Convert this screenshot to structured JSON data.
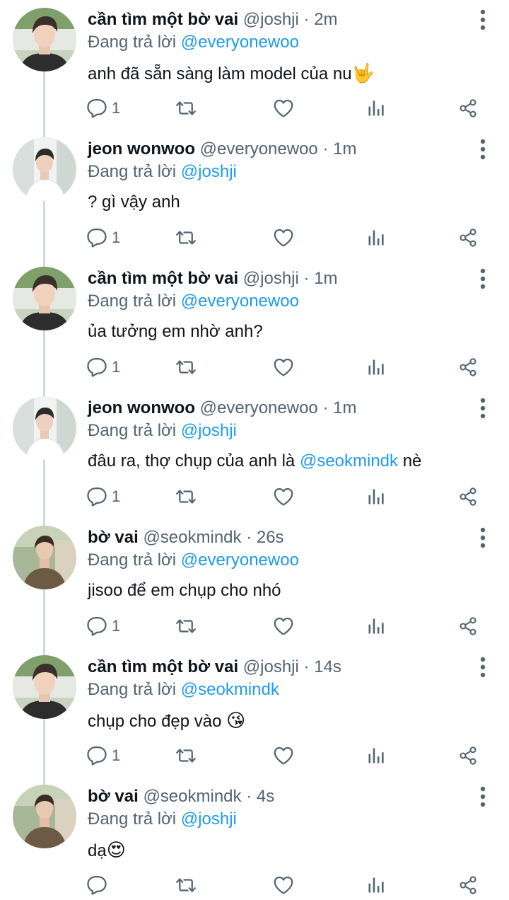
{
  "colors": {
    "link": "#1d9bf0",
    "secondary_text": "#536471",
    "primary_text": "#0f1419",
    "thread_line": "#cfd9de"
  },
  "icons": {
    "reply": "reply-icon",
    "retweet": "retweet-icon",
    "like": "heart-icon",
    "stats": "analytics-icon",
    "share": "share-icon",
    "more": "more-vertical-icon"
  },
  "replying_label": "Đang trả lời",
  "tweets": [
    {
      "name": "cần tìm một bờ vai",
      "handle": "@joshji",
      "dot": "·",
      "time": "2m",
      "replying_to": "@everyonewoo",
      "text": "anh đã sẵn sàng làm model của nu",
      "emoji": "🤟",
      "reply_count": "1"
    },
    {
      "name": "jeon wonwoo",
      "handle": "@everyonewoo",
      "dot": "·",
      "time": "1m",
      "replying_to": "@joshji",
      "text": "? gì vậy anh",
      "emoji": "",
      "reply_count": "1"
    },
    {
      "name": "cần tìm một bờ vai",
      "handle": "@joshji",
      "dot": "·",
      "time": "1m",
      "replying_to": "@everyonewoo",
      "text": "ủa tưởng em nhờ anh?",
      "emoji": "",
      "reply_count": "1"
    },
    {
      "name": "jeon wonwoo",
      "handle": "@everyonewoo",
      "dot": "·",
      "time": "1m",
      "replying_to": "@joshji",
      "text_before": "đâu ra, thợ chụp của anh là ",
      "text_mention": "@seokmindk",
      "text_after": " nè",
      "reply_count": "1"
    },
    {
      "name": "bờ vai",
      "handle": "@seokmindk",
      "dot": "·",
      "time": "26s",
      "replying_to": "@everyonewoo",
      "text": "jisoo để em chụp cho nhó",
      "emoji": "",
      "reply_count": "1"
    },
    {
      "name": "cần tìm một bờ vai",
      "handle": "@joshji",
      "dot": "·",
      "time": "14s",
      "replying_to": "@seokmindk",
      "text": "chụp cho đẹp vào ",
      "emoji": "😘",
      "reply_count": "1"
    },
    {
      "name": "bờ vai",
      "handle": "@seokmindk",
      "dot": "·",
      "time": "4s",
      "replying_to": "@joshji",
      "text": "dạ",
      "emoji": "😍",
      "reply_count": ""
    }
  ]
}
